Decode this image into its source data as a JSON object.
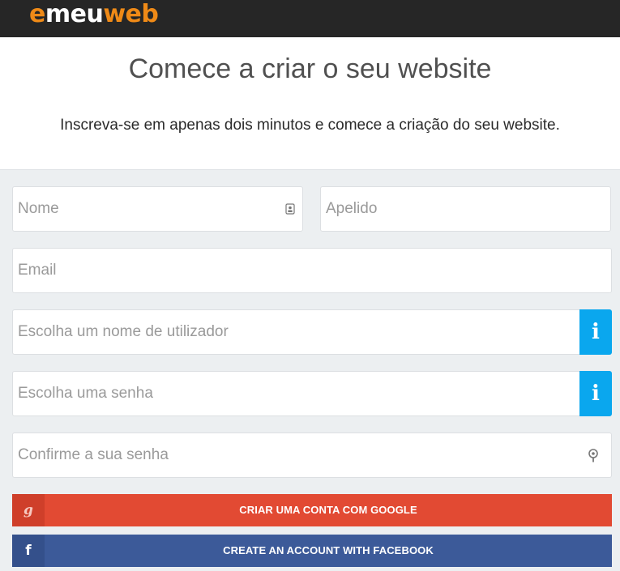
{
  "brand": {
    "logo_part1": "e",
    "logo_part2": "meu",
    "logo_part3": "web",
    "accent_color": "#ef8a17"
  },
  "header": {
    "title": "Comece a criar o seu website",
    "subtitle": "Inscreva-se em apenas dois minutos e comece a criação do seu website."
  },
  "form": {
    "first_name_placeholder": "Nome",
    "last_name_placeholder": "Apelido",
    "email_placeholder": "Email",
    "username_placeholder": "Escolha um nome de utilizador",
    "password_placeholder": "Escolha uma senha",
    "confirm_password_placeholder": "Confirme a sua senha",
    "info_glyph": "i",
    "info_color": "#0aa7ee",
    "icons": {
      "first_name": "contact-card-icon",
      "confirm_password": "key-icon",
      "username_info": "info-icon",
      "password_info": "info-icon"
    }
  },
  "social": {
    "google_glyph": "g",
    "google_label": "CRIAR UMA CONTA COM GOOGLE",
    "google_color": "#e24a33",
    "facebook_glyph": "f",
    "facebook_label": "CREATE AN ACCOUNT WITH FACEBOOK",
    "facebook_color": "#3c5a99"
  }
}
